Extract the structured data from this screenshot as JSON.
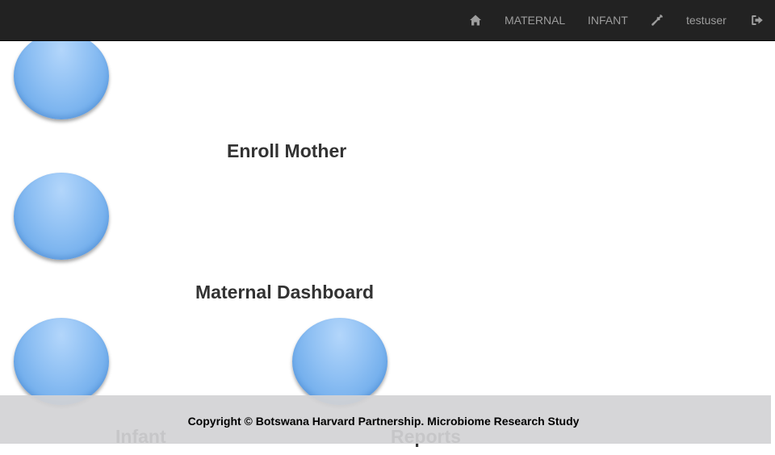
{
  "navbar": {
    "home_icon": "home-icon",
    "maternal_label": "MATERNAL",
    "infant_label": "INFANT",
    "admin_icon": "wrench-icon",
    "user_label": "testuser",
    "logout_icon": "sign-out-icon"
  },
  "tiles": [
    {
      "label": "Enroll Mother"
    },
    {
      "label": "Maternal Dashboard"
    },
    {
      "label": "Infant"
    },
    {
      "label": "Reports"
    }
  ],
  "footer": {
    "text": "Copyright © Botswana Harvard Partnership. Microbiome Research Study"
  },
  "colors": {
    "navbar_bg": "#222222",
    "nav_text": "#9d9d9d",
    "circle_blue": "#8dbff3",
    "footer_bg": "#d2d3d5"
  }
}
